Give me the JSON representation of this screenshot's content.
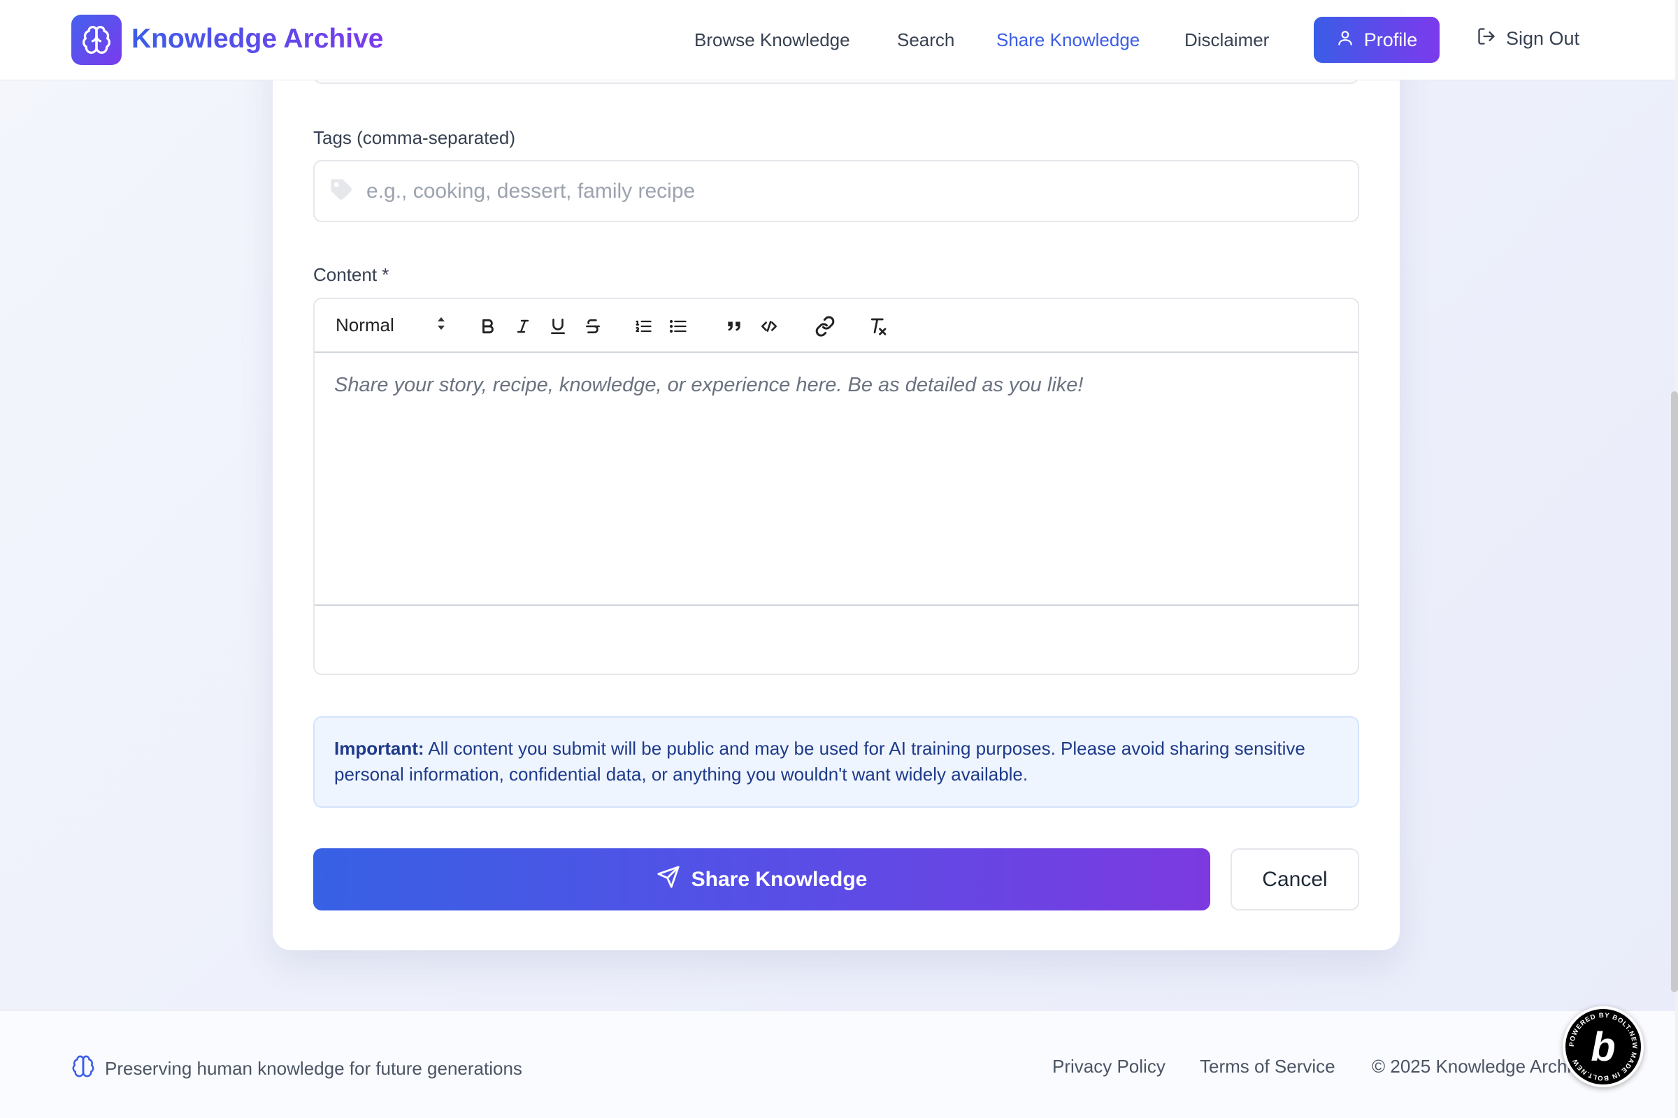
{
  "header": {
    "logo_text": "Knowledge Archive",
    "nav": {
      "browse": "Browse Knowledge",
      "search": "Search",
      "share": "Share Knowledge",
      "disclaimer": "Disclaimer"
    },
    "profile_label": "Profile",
    "signout_label": "Sign Out"
  },
  "form": {
    "tags_label": "Tags (comma-separated)",
    "tags_placeholder": "e.g., cooking, dessert, family recipe",
    "tags_value": "",
    "content_label": "Content *",
    "toolbar": {
      "format_select": "Normal",
      "buttons": [
        "bold-icon",
        "italic-icon",
        "underline-icon",
        "strike-icon",
        "ordered-list-icon",
        "bullet-list-icon",
        "blockquote-icon",
        "code-icon",
        "link-icon",
        "clear-format-icon"
      ]
    },
    "content_placeholder": "Share your story, recipe, knowledge, or experience here. Be as detailed as you like!",
    "notice_title": "Important:",
    "notice_text": " All content you submit will be public and may be used for AI training purposes. Please avoid sharing sensitive personal information, confidential data, or anything you wouldn't want widely available.",
    "submit_label": "Share Knowledge",
    "cancel_label": "Cancel"
  },
  "footer": {
    "tagline": "Preserving human knowledge for future generations",
    "privacy": "Privacy Policy",
    "terms": "Terms of Service",
    "copyright": "© 2025 Knowledge Archive"
  },
  "badge": {
    "letter": "b",
    "ring_text": "POWERED BY BOLT.NEW MADE IN BOLT.NEW"
  },
  "colors": {
    "accent": "#3b5de7",
    "accent_purple": "#7c3aed",
    "notice_text": "#1e3a8a"
  }
}
